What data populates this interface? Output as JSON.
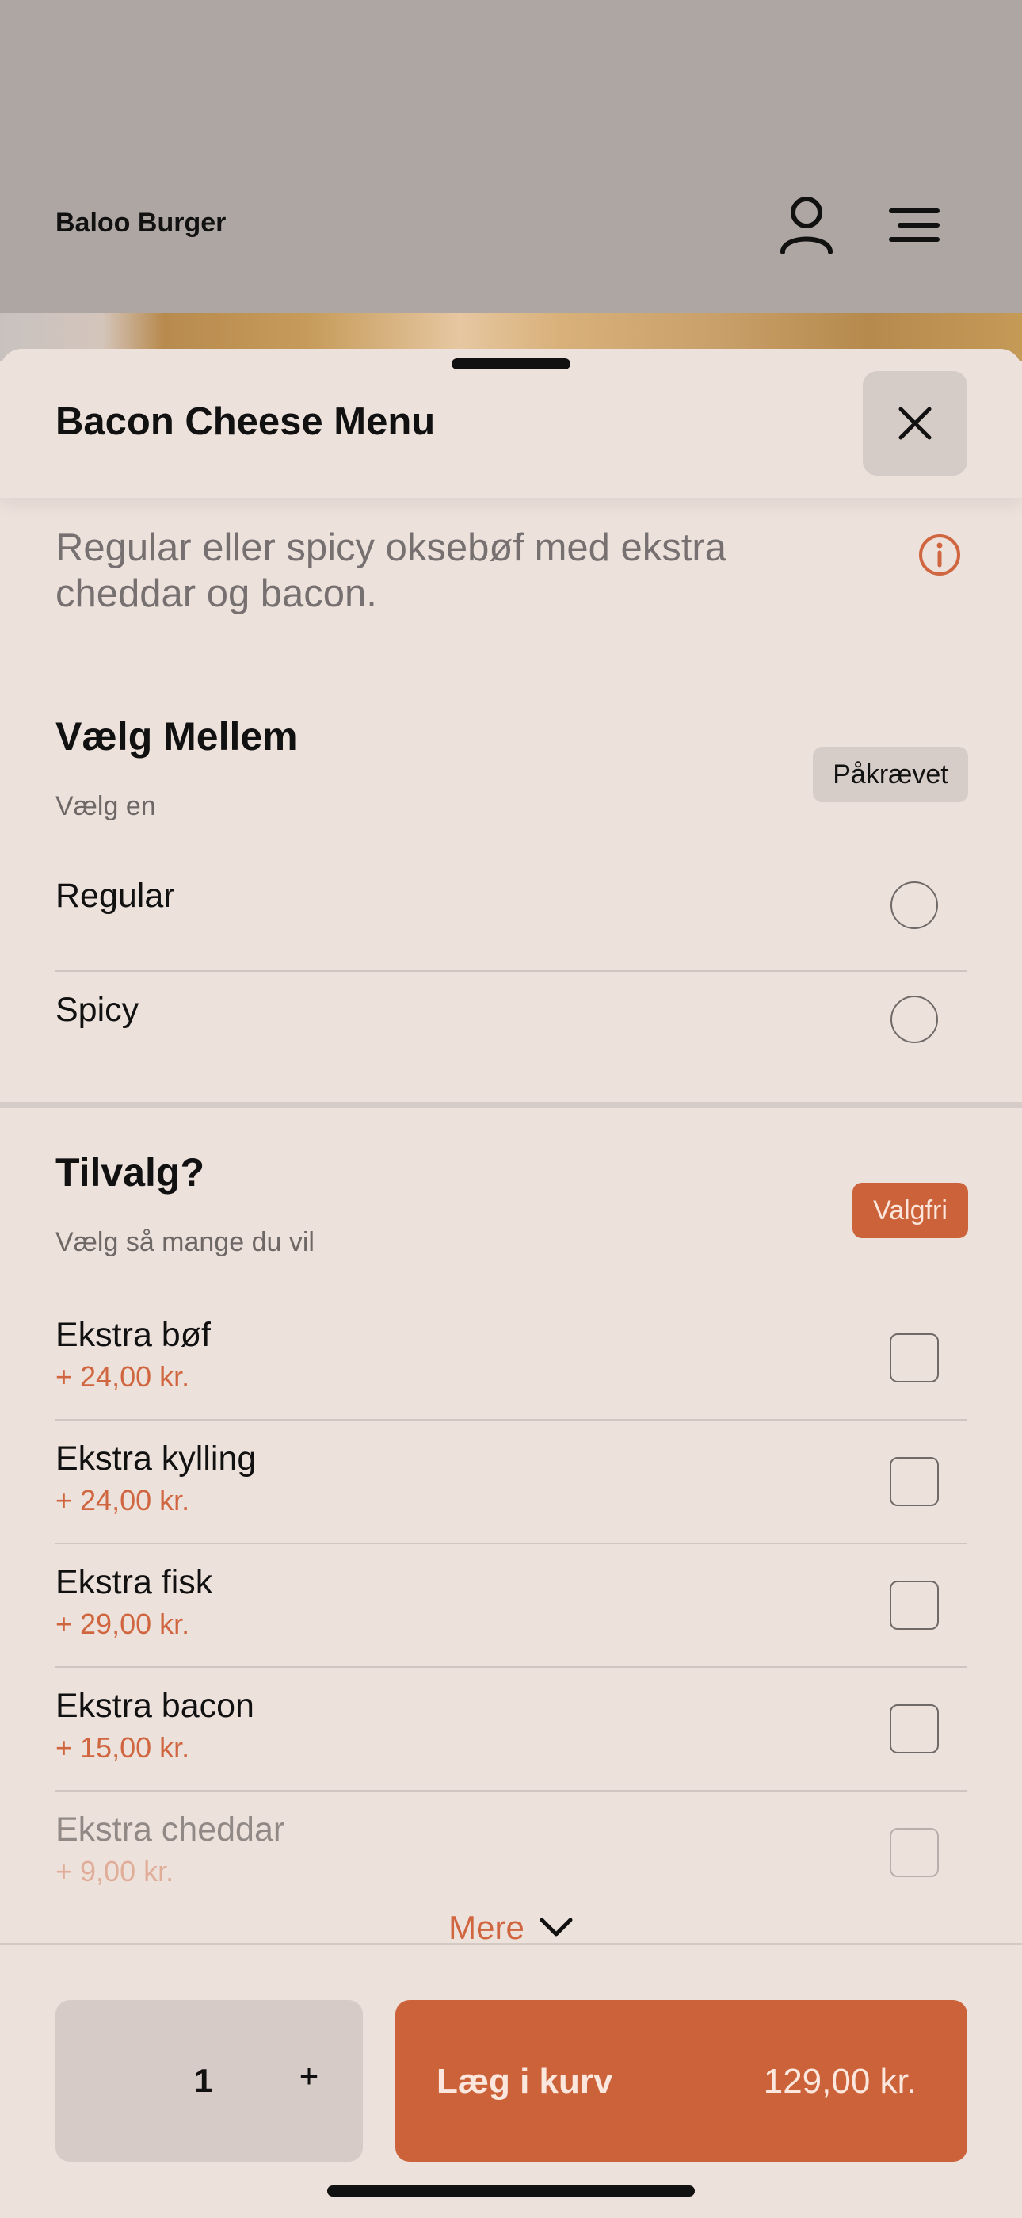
{
  "header": {
    "brand": "Baloo Burger",
    "account_icon": "person-icon",
    "menu_icon": "menu-icon"
  },
  "sheet": {
    "title": "Bacon Cheese Menu",
    "close_icon": "close-icon",
    "description": "Regular eller spicy oksebøf med ekstra cheddar og bacon.",
    "info_icon": "info-icon"
  },
  "group_size": {
    "title": "Vælg Mellem",
    "subtitle": "Vælg en",
    "badge": "Påkrævet",
    "options": [
      {
        "label": "Regular"
      },
      {
        "label": "Spicy"
      }
    ]
  },
  "group_extras": {
    "title": "Tilvalg?",
    "subtitle": "Vælg så mange du vil",
    "badge": "Valgfri",
    "options": [
      {
        "label": "Ekstra bøf",
        "price": "+ 24,00 kr."
      },
      {
        "label": "Ekstra kylling",
        "price": "+ 24,00 kr."
      },
      {
        "label": "Ekstra fisk",
        "price": "+ 29,00 kr."
      },
      {
        "label": "Ekstra bacon",
        "price": "+ 15,00 kr."
      },
      {
        "label": "Ekstra cheddar",
        "price": "+ 9,00 kr."
      }
    ],
    "more_label": "Mere"
  },
  "footer": {
    "quantity": "1",
    "plus": "+",
    "add_label": "Læg i kurv",
    "add_price": "129,00 kr."
  },
  "colors": {
    "accent": "#cc6239",
    "background": "#ede1dc",
    "header": "#aea6a3"
  }
}
